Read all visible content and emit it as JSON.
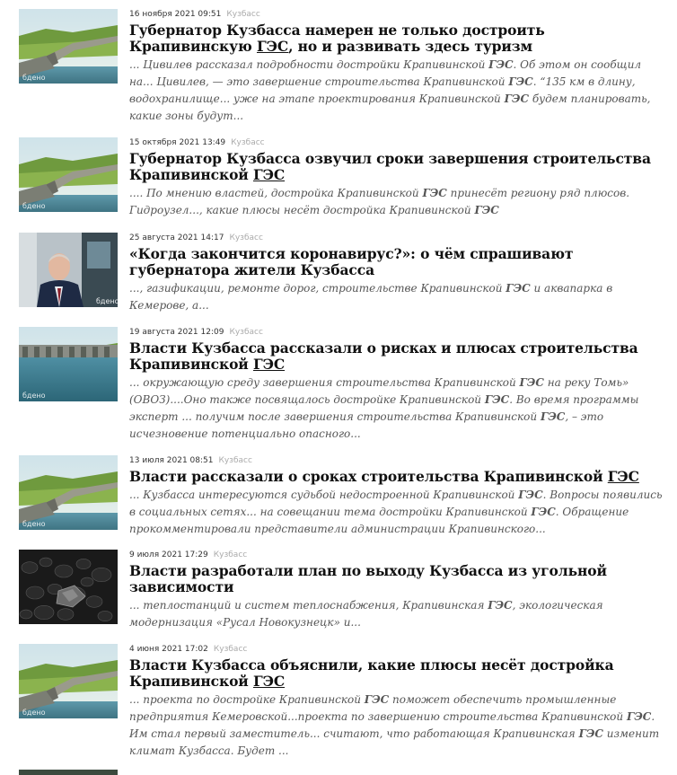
{
  "items": [
    {
      "date": "16 ноября 2021 09:51",
      "region": "Кузбасс",
      "title_pre": "Губернатор Кузбасса намерен не только достроить Крапивинскую ",
      "title_hl": "ГЭС",
      "title_post": ", но и развивать здесь туризм",
      "snippet": [
        [
          "... Цивилев рассказал подробности достройки Крапивинской ",
          "ГЭС",
          ". Об этом он сообщил на... Цивилев, — это завершение строительства Крапивинской ",
          "ГЭС",
          ". “135 км в длину, водохранилище... уже на этапе проектирования Крапивинской ",
          "ГЭС",
          " будем планировать, какие зоны будут..."
        ]
      ],
      "thumb": "dam"
    },
    {
      "date": "15 октября 2021 13:49",
      "region": "Кузбасс",
      "title_pre": "Губернатор Кузбасса озвучил сроки завершения строительства Крапивинской ",
      "title_hl": "ГЭС",
      "title_post": "",
      "snippet": [
        [
          ".... По мнению властей, достройка Крапивинской ",
          "ГЭС",
          " принесёт региону ряд плюсов. Гидроузел..., какие плюсы несёт достройка Крапивинской ",
          "ГЭС",
          ""
        ]
      ],
      "thumb": "dam"
    },
    {
      "date": "25 августа 2021 14:17",
      "region": "Кузбасс",
      "title_pre": "«Когда закончится коронавирус?»: о чём спрашивают губернатора жители Кузбасса",
      "title_hl": "",
      "title_post": "",
      "snippet": [
        [
          "..., газификации, ремонте дорог, строительстве Крапивинской ",
          "ГЭС",
          " и аквапарка в Кемерове, а..."
        ]
      ],
      "thumb": "person"
    },
    {
      "date": "19 августа 2021 12:09",
      "region": "Кузбасс",
      "title_pre": "Власти Кузбасса рассказали о рисках и плюсах строительства Крапивинской ",
      "title_hl": "ГЭС",
      "title_post": "",
      "snippet": [
        [
          "... окружающую среду завершения строительства Крапивинской ",
          "ГЭС",
          " на реку Томь» (ОВОЗ)....Оно также посвящалось достройке Крапивинской ",
          "ГЭС",
          ". Во время программы эксперт ... получим после завершения строительства Крапивинской ",
          "ГЭС",
          ", – это исчезновение потенциально опасного..."
        ]
      ],
      "thumb": "dam2"
    },
    {
      "date": "13 июля 2021 08:51",
      "region": "Кузбасс",
      "title_pre": "Власти рассказали о сроках строительства Крапивинской ",
      "title_hl": "ГЭС",
      "title_post": "",
      "snippet": [
        [
          "... Кузбасса интересуются судьбой недостроенной Крапивинской ",
          "ГЭС",
          ". Вопросы появились в социальных сетях... на совещании тема достройки Крапивинской ",
          "ГЭС",
          ". Обращение прокомментировали представители администрации Крапивинского..."
        ]
      ],
      "thumb": "dam"
    },
    {
      "date": "9 июля 2021 17:29",
      "region": "Кузбасс",
      "title_pre": "Власти разработали план по выходу Кузбасса из угольной зависимости",
      "title_hl": "",
      "title_post": "",
      "snippet": [
        [
          "... теплостанций и систем теплоснабжения, Крапивинская ",
          "ГЭС",
          ", экологическая модернизация «Русал Новокузнецк» и..."
        ]
      ],
      "thumb": "coal"
    },
    {
      "date": "4 июня 2021 17:02",
      "region": "Кузбасс",
      "title_pre": "Власти Кузбасса объяснили, какие плюсы несёт достройка Крапивинской ",
      "title_hl": "ГЭС",
      "title_post": "",
      "snippet": [
        [
          "... проекта по достройке Крапивинской ",
          "ГЭС",
          " поможет обеспечить промышленные предприятия Кемеровской...проекта по завершению строительства Крапивинской ",
          "ГЭС",
          ". Им стал первый заместитель... считают, что работающая Крапивинская ",
          "ГЭС",
          " изменит климат Кузбасса. Будет ..."
        ]
      ],
      "thumb": "dam"
    }
  ],
  "watermark": "бдено"
}
